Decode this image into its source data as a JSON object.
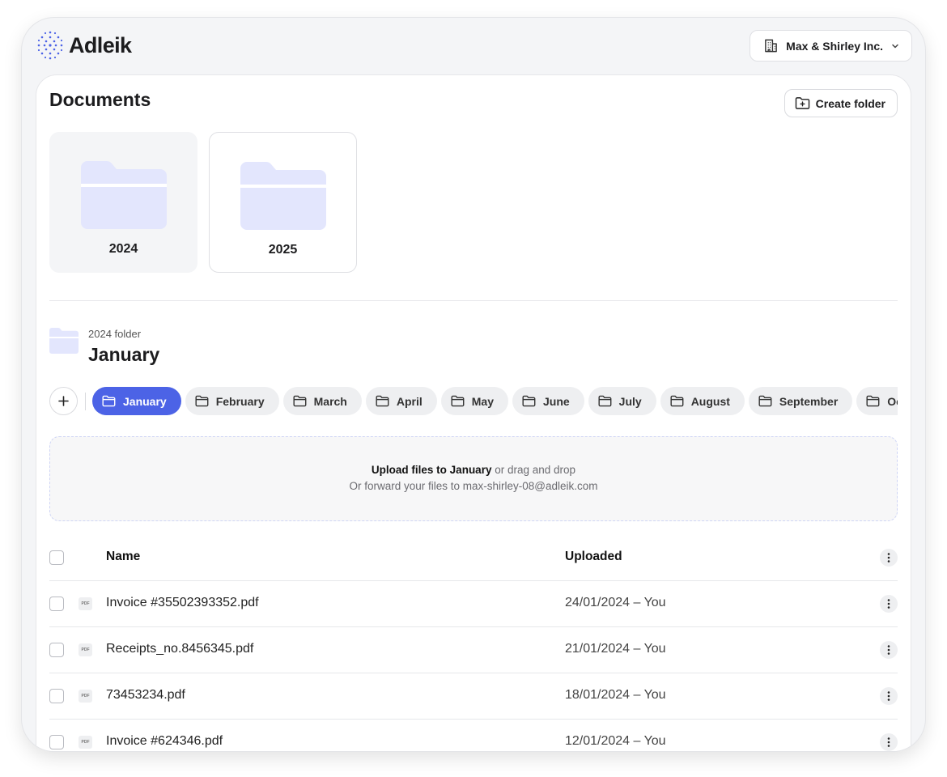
{
  "app": {
    "brand": "Adleik"
  },
  "org_switcher": {
    "label": "Max & Shirley Inc."
  },
  "documents": {
    "title": "Documents",
    "create_folder_label": "Create folder",
    "years": [
      "2024",
      "2025"
    ]
  },
  "folder": {
    "parent_label": "2024 folder",
    "title": "January",
    "months": [
      "January",
      "February",
      "March",
      "April",
      "May",
      "June",
      "July",
      "August",
      "September",
      "October"
    ],
    "active_month": "January"
  },
  "upload": {
    "action": "Upload files to January",
    "hint": "or drag and drop",
    "forward_text": "Or forward your files to max-shirley-08@adleik.com"
  },
  "files_table": {
    "columns": {
      "name": "Name",
      "uploaded": "Uploaded"
    },
    "file_type_badge": "PDF",
    "rows": [
      {
        "name": "Invoice #35502393352.pdf",
        "uploaded": "24/01/2024  –  You"
      },
      {
        "name": "Receipts_no.8456345.pdf",
        "uploaded": "21/01/2024  –  You"
      },
      {
        "name": "73453234.pdf",
        "uploaded": "18/01/2024  –  You"
      },
      {
        "name": "Invoice #624346.pdf",
        "uploaded": "12/01/2024  –  You"
      }
    ]
  },
  "colors": {
    "accent": "#4c63e6",
    "folder_fill": "#e3e6fd",
    "surface": "#f4f5f7"
  }
}
